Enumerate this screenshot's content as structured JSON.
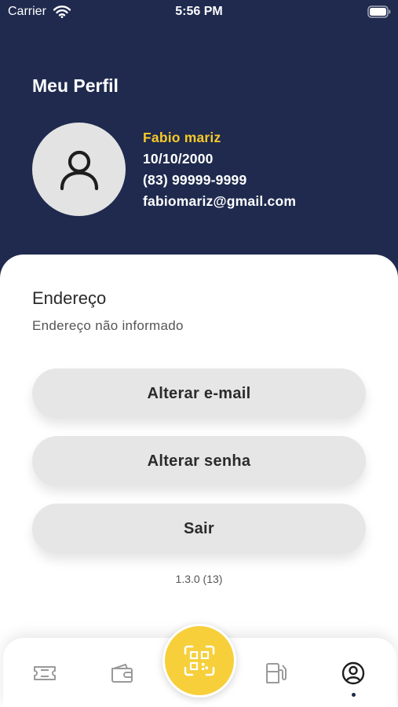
{
  "status_bar": {
    "carrier": "Carrier",
    "time": "5:56 PM"
  },
  "header": {
    "title": "Meu Perfil"
  },
  "profile": {
    "name": "Fabio mariz",
    "birthdate": "10/10/2000",
    "phone": "(83) 99999-9999",
    "email": "fabiomariz@gmail.com"
  },
  "address": {
    "title": "Endereço",
    "value": "Endereço não informado"
  },
  "actions": {
    "change_email": "Alterar e-mail",
    "change_password": "Alterar senha",
    "logout": "Sair"
  },
  "version": "1.3.0 (13)",
  "tab_bar": {
    "items": [
      {
        "icon": "ticket-icon"
      },
      {
        "icon": "wallet-icon"
      },
      {
        "icon": "qr-scan-icon"
      },
      {
        "icon": "fuel-pump-icon"
      },
      {
        "icon": "user-circle-icon"
      }
    ],
    "active_index": 4
  },
  "colors": {
    "header_bg": "#1f2a4e",
    "accent_yellow": "#f6c928",
    "button_bg": "#e6e6e6"
  }
}
